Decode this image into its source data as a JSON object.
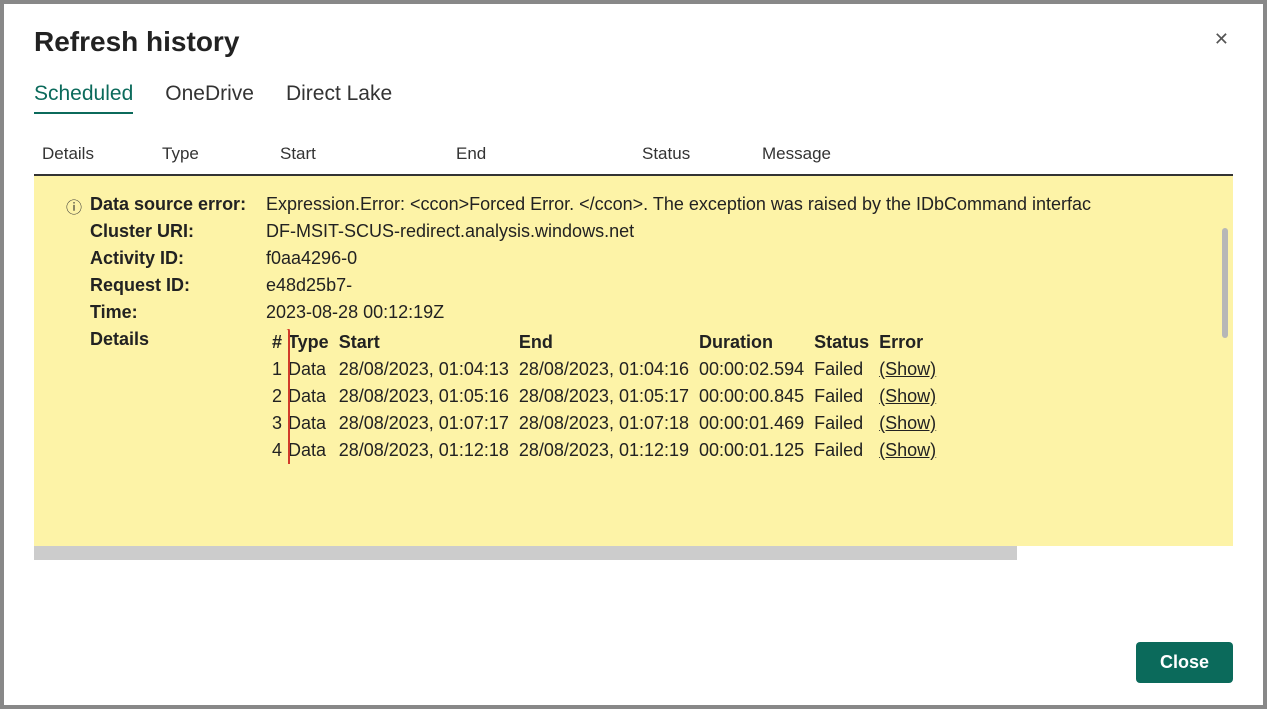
{
  "dialog": {
    "title": "Refresh history",
    "close_label": "Close"
  },
  "tabs": [
    {
      "label": "Scheduled",
      "active": true
    },
    {
      "label": "OneDrive",
      "active": false
    },
    {
      "label": "Direct Lake",
      "active": false
    }
  ],
  "columns": [
    "Details",
    "Type",
    "Start",
    "End",
    "Status",
    "Message"
  ],
  "error_panel": {
    "rows": [
      {
        "label": "Data source error:",
        "value": "Expression.Error: <ccon>Forced Error. </ccon>. The exception was raised by the IDbCommand interfac"
      },
      {
        "label": "Cluster URI:",
        "value": "DF-MSIT-SCUS-redirect.analysis.windows.net"
      },
      {
        "label": "Activity ID:",
        "value": "f0aa4296-0"
      },
      {
        "label": "Request ID:",
        "value": "e48d25b7-"
      },
      {
        "label": "Time:",
        "value": "2023-08-28 00:12:19Z"
      }
    ],
    "details_label": "Details",
    "details_headers": [
      "#",
      "Type",
      "Start",
      "End",
      "Duration",
      "Status",
      "Error"
    ],
    "details_rows": [
      {
        "n": "1",
        "type": "Data",
        "start": "28/08/2023, 01:04:13",
        "end": "28/08/2023, 01:04:16",
        "duration": "00:00:02.594",
        "status": "Failed",
        "error": "(Show)"
      },
      {
        "n": "2",
        "type": "Data",
        "start": "28/08/2023, 01:05:16",
        "end": "28/08/2023, 01:05:17",
        "duration": "00:00:00.845",
        "status": "Failed",
        "error": "(Show)"
      },
      {
        "n": "3",
        "type": "Data",
        "start": "28/08/2023, 01:07:17",
        "end": "28/08/2023, 01:07:18",
        "duration": "00:00:01.469",
        "status": "Failed",
        "error": "(Show)"
      },
      {
        "n": "4",
        "type": "Data",
        "start": "28/08/2023, 01:12:18",
        "end": "28/08/2023, 01:12:19",
        "duration": "00:00:01.125",
        "status": "Failed",
        "error": "(Show)"
      }
    ]
  }
}
